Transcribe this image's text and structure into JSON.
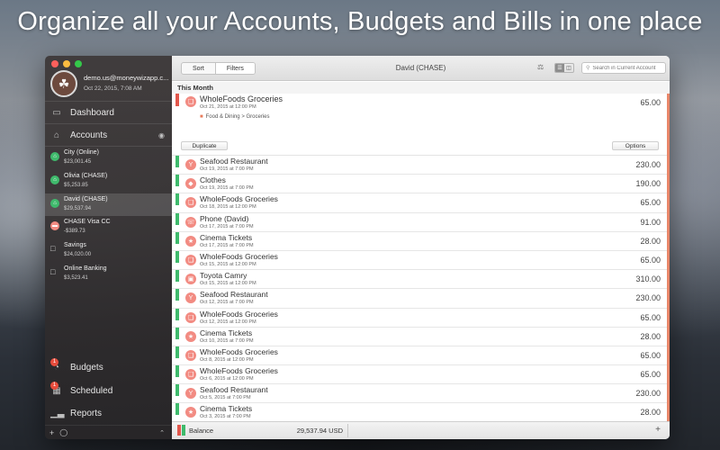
{
  "headline": "Organize all your Accounts, Budgets and Bills in one place",
  "user": {
    "email": "demo.us@moneywizapp.c...",
    "datetime": "Oct 22, 2015, 7:08 AM"
  },
  "nav": {
    "dashboard": "Dashboard",
    "accounts": "Accounts",
    "budgets": "Budgets",
    "scheduled": "Scheduled",
    "reports": "Reports",
    "budgets_badge": "1",
    "scheduled_badge": "1"
  },
  "accounts": [
    {
      "name": "City (Online)",
      "balance": "$23,001.45",
      "color": "#3fba6c",
      "kind": "bank"
    },
    {
      "name": "Olivia (CHASE)",
      "balance": "$5,253.85",
      "color": "#3fba6c",
      "kind": "bank"
    },
    {
      "name": "David (CHASE)",
      "balance": "$29,537.94",
      "color": "#3fba6c",
      "kind": "bank"
    },
    {
      "name": "CHASE Visa CC",
      "balance": "-$389.73",
      "color": "#f28b82",
      "kind": "card"
    },
    {
      "name": "Savings",
      "balance": "$24,020.00",
      "color": "",
      "kind": "folder"
    },
    {
      "name": "Online Banking",
      "balance": "$3,523.41",
      "color": "",
      "kind": "folder"
    }
  ],
  "toolbar": {
    "sort": "Sort",
    "filters": "Filters",
    "title": "David (CHASE)",
    "search_placeholder": "Search in Current Account"
  },
  "section_title": "This Month",
  "expanded": {
    "title": "WholeFoods Groceries",
    "date": "Oct 21, 2015 at 12:00 PM",
    "amount": "65.00",
    "category": "Food & Dining > Groceries",
    "duplicate": "Duplicate",
    "options": "Options"
  },
  "transactions": [
    {
      "title": "Seafood Restaurant",
      "date": "Oct 19, 2015 at 7:00 PM",
      "amount": "230.00",
      "icon": "glass"
    },
    {
      "title": "Clothes",
      "date": "Oct 19, 2015 at 7:00 PM",
      "amount": "190.00",
      "icon": "tag"
    },
    {
      "title": "WholeFoods Groceries",
      "date": "Oct 18, 2015 at 12:00 PM",
      "amount": "65.00",
      "icon": "basket"
    },
    {
      "title": "Phone (David)",
      "date": "Oct 17, 2015 at 7:00 PM",
      "amount": "91.00",
      "icon": "phone"
    },
    {
      "title": "Cinema Tickets",
      "date": "Oct 17, 2015 at 7:00 PM",
      "amount": "28.00",
      "icon": "star"
    },
    {
      "title": "WholeFoods Groceries",
      "date": "Oct 15, 2015 at 12:00 PM",
      "amount": "65.00",
      "icon": "basket"
    },
    {
      "title": "Toyota Camry",
      "date": "Oct 15, 2015 at 12:00 PM",
      "amount": "310.00",
      "icon": "car"
    },
    {
      "title": "Seafood Restaurant",
      "date": "Oct 12, 2015 at 7:00 PM",
      "amount": "230.00",
      "icon": "glass"
    },
    {
      "title": "WholeFoods Groceries",
      "date": "Oct 12, 2015 at 12:00 PM",
      "amount": "65.00",
      "icon": "basket"
    },
    {
      "title": "Cinema Tickets",
      "date": "Oct 10, 2015 at 7:00 PM",
      "amount": "28.00",
      "icon": "star"
    },
    {
      "title": "WholeFoods Groceries",
      "date": "Oct 8, 2015 at 12:00 PM",
      "amount": "65.00",
      "icon": "basket"
    },
    {
      "title": "WholeFoods Groceries",
      "date": "Oct 6, 2015 at 12:00 PM",
      "amount": "65.00",
      "icon": "basket"
    },
    {
      "title": "Seafood Restaurant",
      "date": "Oct 5, 2015 at 7:00 PM",
      "amount": "230.00",
      "icon": "glass"
    },
    {
      "title": "Cinema Tickets",
      "date": "Oct 3, 2015 at 7:00 PM",
      "amount": "28.00",
      "icon": "star"
    }
  ],
  "footer": {
    "label": "Balance",
    "value": "29,537.94 USD"
  }
}
